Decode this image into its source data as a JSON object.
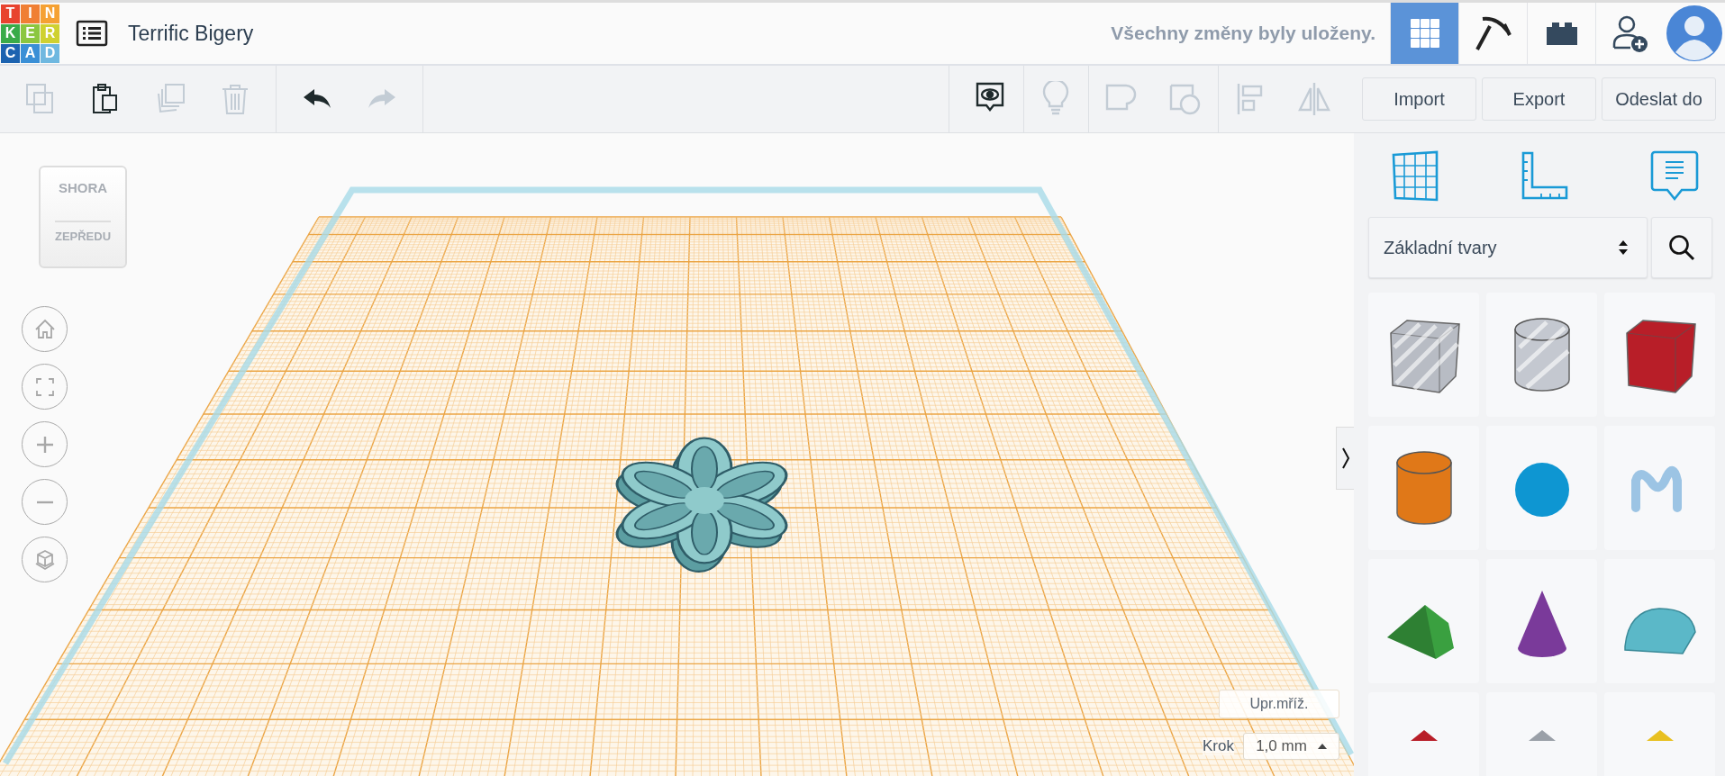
{
  "logo": {
    "letters": [
      {
        "char": "T",
        "color": "#e8432e"
      },
      {
        "char": "I",
        "color": "#f07f34"
      },
      {
        "char": "N",
        "color": "#f5a133"
      },
      {
        "char": "K",
        "color": "#3aab49"
      },
      {
        "char": "E",
        "color": "#8cc63f"
      },
      {
        "char": "R",
        "color": "#cfd130"
      },
      {
        "char": "C",
        "color": "#1c63b0"
      },
      {
        "char": "A",
        "color": "#3a8fd6"
      },
      {
        "char": "D",
        "color": "#6fb8e0"
      }
    ]
  },
  "design_title": "Terrific Bigery",
  "save_status": "Všechny změny byly uloženy.",
  "header_nav": [
    {
      "kind": "grid",
      "selected": true
    },
    {
      "kind": "pickaxe",
      "selected": false
    },
    {
      "kind": "brick",
      "selected": false
    },
    {
      "kind": "add-user",
      "selected": false
    }
  ],
  "toolbar": {
    "edit_tools": [
      {
        "kind": "copy",
        "disabled": true
      },
      {
        "kind": "paste",
        "disabled": false
      },
      {
        "kind": "duplicate",
        "disabled": true
      },
      {
        "kind": "delete",
        "disabled": true
      }
    ],
    "history": [
      {
        "kind": "undo",
        "disabled": false
      },
      {
        "kind": "redo",
        "disabled": true
      }
    ],
    "view_tools": [
      {
        "kind": "notes",
        "disabled": false
      },
      {
        "kind": "light",
        "disabled": true
      },
      {
        "kind": "group",
        "disabled": true
      },
      {
        "kind": "hole",
        "disabled": true
      },
      {
        "kind": "align",
        "disabled": true
      },
      {
        "kind": "mirror",
        "disabled": true
      }
    ],
    "buttons": [
      "Import",
      "Export",
      "Odeslat do"
    ]
  },
  "view_cube": {
    "top": "SHORA",
    "front": "ZEPŘEDU"
  },
  "view_controls": [
    {
      "kind": "home"
    },
    {
      "kind": "fit"
    },
    {
      "kind": "zoom-in"
    },
    {
      "kind": "zoom-out"
    },
    {
      "kind": "ortho"
    }
  ],
  "grid_settings": {
    "edit_button": "Upr.mříž.",
    "step_label": "Krok",
    "step_value": "1,0 mm"
  },
  "panel": {
    "tools": [
      {
        "kind": "workplane"
      },
      {
        "kind": "ruler"
      },
      {
        "kind": "notes"
      }
    ],
    "category": "Základní tvary",
    "shapes": [
      {
        "kind": "box-hole",
        "color": "#b8bcc4"
      },
      {
        "kind": "cylinder-hole",
        "color": "#c4c8d0"
      },
      {
        "kind": "box",
        "color": "#b81e28"
      },
      {
        "kind": "cylinder",
        "color": "#e07818"
      },
      {
        "kind": "sphere",
        "color": "#0e96d2"
      },
      {
        "kind": "scribble",
        "color": "#9cc4e4"
      },
      {
        "kind": "roof",
        "color": "#3aa040"
      },
      {
        "kind": "cone",
        "color": "#7a3a9a"
      },
      {
        "kind": "round-roof",
        "color": "#5bb8c8"
      },
      {
        "kind": "cut",
        "color": "#b81e28"
      },
      {
        "kind": "cut",
        "color": "#9aa0a8"
      },
      {
        "kind": "cut",
        "color": "#e8c020"
      }
    ]
  }
}
